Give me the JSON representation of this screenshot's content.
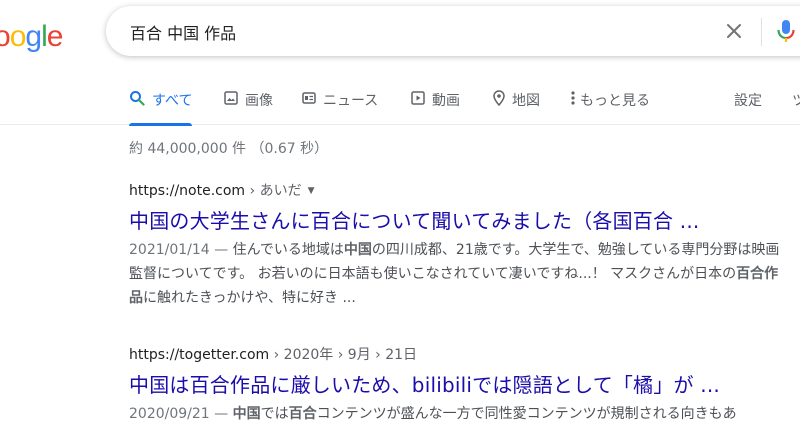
{
  "logo": {
    "text": "oogle"
  },
  "search": {
    "query": "百合 中国 作品"
  },
  "tabs": [
    {
      "label": "すべて",
      "icon": "search-icon"
    },
    {
      "label": "画像",
      "icon": "image-icon"
    },
    {
      "label": "ニュース",
      "icon": "news-icon"
    },
    {
      "label": "動画",
      "icon": "video-icon"
    },
    {
      "label": "地図",
      "icon": "map-pin-icon"
    },
    {
      "label": "もっと見る",
      "icon": "more-vert-icon"
    },
    {
      "label": "設定"
    },
    {
      "label": "ツ"
    }
  ],
  "stats": "約 44,000,000 件 （0.67 秒）",
  "results": [
    {
      "site": "https://note.com",
      "path": " › あいだ",
      "title": "中国の大学生さんに百合について聞いてみました（各国百合 ...",
      "date": "2021/01/14 — ",
      "snippet_parts": [
        "住んでいる地域は",
        "中国",
        "の四川成都、21歳です。大学生で、勉強している専門分野は映画監督についてです。 お若いのに日本語も使いこなされていて凄いですね...！ マスクさんが日本の",
        "百合作品",
        "に触れたきっかけや、特に好き ..."
      ]
    },
    {
      "site": "https://togetter.com",
      "path": " › 2020年 › 9月 › 21日",
      "title": "中国は百合作品に厳しいため、bilibiliでは隠語として「橘」が ...",
      "date": "2020/09/21 — ",
      "snippet_parts": [
        "中国",
        "では",
        "百合",
        "コンテンツが盛んな一方で同性愛コンテンツが規制される向きもあ"
      ]
    }
  ],
  "colors": {
    "link": "#1a0dab",
    "accent": "#1a73e8",
    "muted": "#70757a"
  }
}
